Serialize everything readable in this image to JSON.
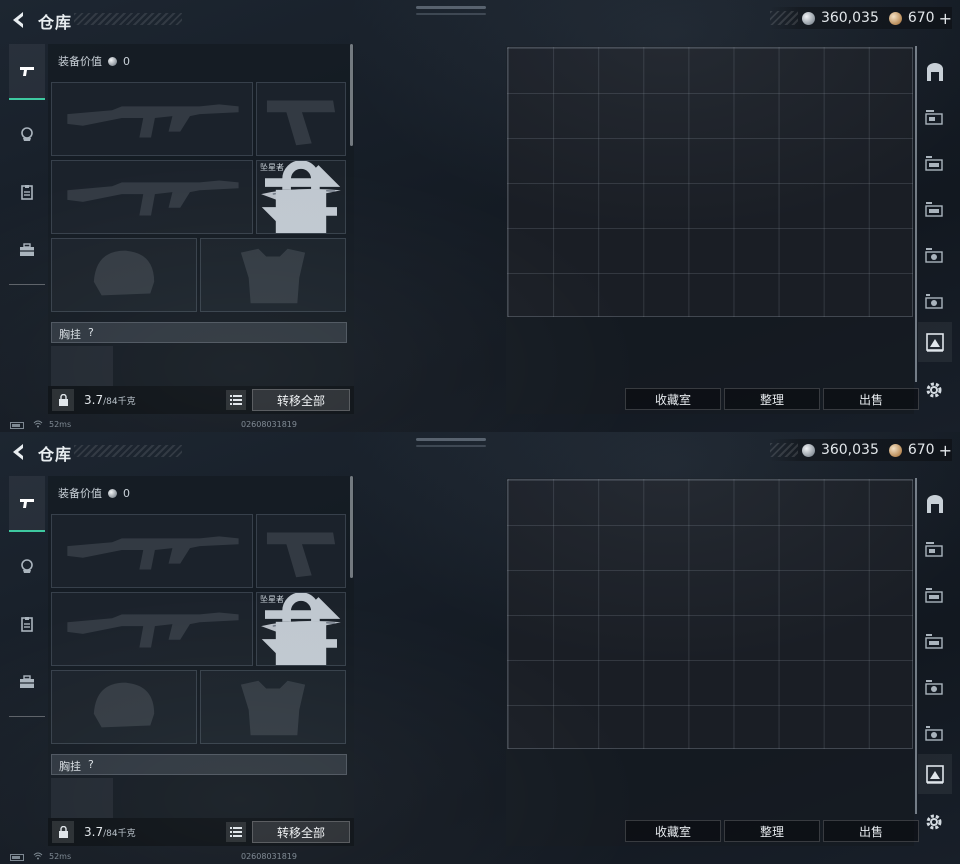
{
  "header": {
    "title": "仓库",
    "currency_silver": "360,035",
    "currency_gold": "670",
    "plus_label": "+"
  },
  "equipment": {
    "value_label": "装备价值",
    "value": "0",
    "knife_name": "坠星者",
    "chest_label": "胸挂",
    "chest_help": "?",
    "weight_current": "3.7",
    "weight_max": "/84千克",
    "transfer_all_label": "转移全部"
  },
  "storage": {
    "collection_label": "收藏室",
    "organize_label": "整理",
    "sell_label": "出售"
  },
  "status": {
    "ping": "52ms",
    "uid": "02608031819"
  },
  "colors": {
    "accent": "#3ec9a0",
    "background": "#151c25"
  },
  "icons": {
    "tabs": [
      "pistol-icon",
      "helmet-badge-icon",
      "clipboard-icon",
      "briefcase-icon"
    ],
    "right_bar": [
      "safe-icon",
      "case-1-icon",
      "case-2-icon",
      "case-3-icon",
      "case-4-icon",
      "case-5-icon",
      "gallery-icon"
    ]
  }
}
